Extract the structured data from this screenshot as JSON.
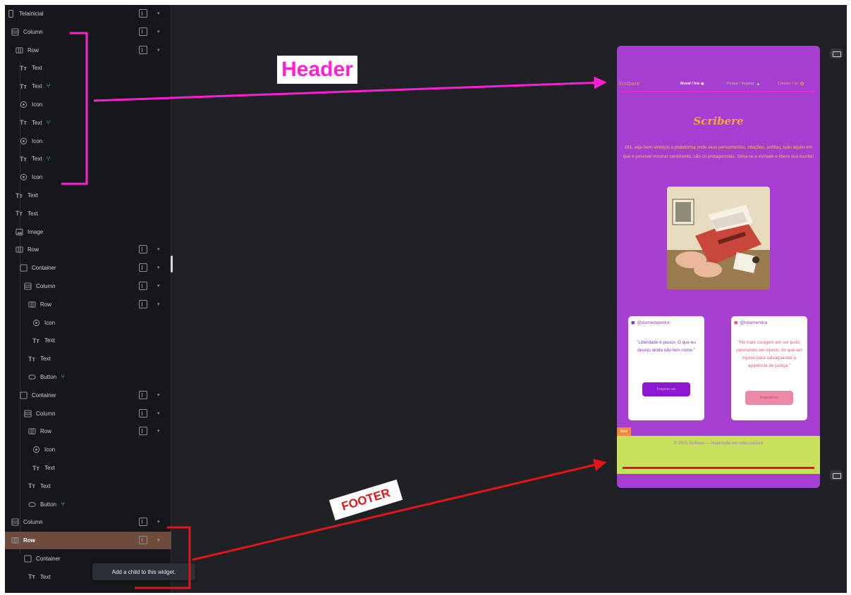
{
  "tree": {
    "items": [
      {
        "label": "Telainicial",
        "icon": "phone-icon",
        "wrap": true,
        "badge": false,
        "kind": "phone"
      },
      {
        "label": "Column",
        "icon": "column-icon",
        "wrap": true,
        "badge": false,
        "kind": "column"
      },
      {
        "label": "Row",
        "icon": "row-icon",
        "wrap": true,
        "badge": false,
        "kind": "row"
      },
      {
        "label": "Text",
        "icon": "text-icon",
        "wrap": false,
        "badge": false,
        "kind": "text"
      },
      {
        "label": "Text",
        "icon": "text-icon",
        "wrap": false,
        "badge": true,
        "kind": "text"
      },
      {
        "label": "Icon",
        "icon": "icon-widget-icon",
        "wrap": false,
        "badge": false,
        "kind": "icon"
      },
      {
        "label": "Text",
        "icon": "text-icon",
        "wrap": false,
        "badge": true,
        "kind": "text"
      },
      {
        "label": "Icon",
        "icon": "icon-widget-icon",
        "wrap": false,
        "badge": false,
        "kind": "icon"
      },
      {
        "label": "Text",
        "icon": "text-icon",
        "wrap": false,
        "badge": true,
        "kind": "text"
      },
      {
        "label": "Icon",
        "icon": "icon-widget-icon",
        "wrap": false,
        "badge": false,
        "kind": "icon"
      },
      {
        "label": "Text",
        "icon": "text-icon",
        "wrap": false,
        "badge": false,
        "kind": "text"
      },
      {
        "label": "Text",
        "icon": "text-icon",
        "wrap": false,
        "badge": false,
        "kind": "text"
      },
      {
        "label": "Image",
        "icon": "image-icon",
        "wrap": false,
        "badge": false,
        "kind": "image"
      },
      {
        "label": "Row",
        "icon": "row-icon",
        "wrap": true,
        "badge": false,
        "kind": "row"
      },
      {
        "label": "Container",
        "icon": "container-icon",
        "wrap": true,
        "badge": false,
        "kind": "container"
      },
      {
        "label": "Column",
        "icon": "column-icon",
        "wrap": true,
        "badge": false,
        "kind": "column"
      },
      {
        "label": "Row",
        "icon": "row-icon",
        "wrap": true,
        "badge": false,
        "kind": "row"
      },
      {
        "label": "Icon",
        "icon": "icon-widget-icon",
        "wrap": false,
        "badge": false,
        "kind": "icon"
      },
      {
        "label": "Text",
        "icon": "text-icon",
        "wrap": false,
        "badge": false,
        "kind": "text"
      },
      {
        "label": "Text",
        "icon": "text-icon",
        "wrap": false,
        "badge": false,
        "kind": "text"
      },
      {
        "label": "Button",
        "icon": "button-icon",
        "wrap": false,
        "badge": true,
        "kind": "button"
      },
      {
        "label": "Container",
        "icon": "container-icon",
        "wrap": true,
        "badge": false,
        "kind": "container"
      },
      {
        "label": "Column",
        "icon": "column-icon",
        "wrap": true,
        "badge": false,
        "kind": "column"
      },
      {
        "label": "Row",
        "icon": "row-icon",
        "wrap": true,
        "badge": false,
        "kind": "row"
      },
      {
        "label": "Icon",
        "icon": "icon-widget-icon",
        "wrap": false,
        "badge": false,
        "kind": "icon"
      },
      {
        "label": "Text",
        "icon": "text-icon",
        "wrap": false,
        "badge": false,
        "kind": "text"
      },
      {
        "label": "Text",
        "icon": "text-icon",
        "wrap": false,
        "badge": false,
        "kind": "text"
      },
      {
        "label": "Button",
        "icon": "button-icon",
        "wrap": false,
        "badge": true,
        "kind": "button"
      },
      {
        "label": "Column",
        "icon": "column-icon",
        "wrap": true,
        "badge": false,
        "kind": "column"
      },
      {
        "label": "Row",
        "icon": "row-icon",
        "wrap": true,
        "badge": false,
        "kind": "row",
        "selected": true
      },
      {
        "label": "Container",
        "icon": "container-icon",
        "wrap": false,
        "badge": false,
        "kind": "container"
      },
      {
        "label": "Text",
        "icon": "text-icon",
        "wrap": false,
        "badge": false,
        "kind": "text"
      }
    ],
    "tooltip": "Add a child to this widget."
  },
  "preview": {
    "brand": "Scribere",
    "nav": [
      {
        "label": "Mural / Ins",
        "icon": "person-icon"
      },
      {
        "label": "Postar / Inspirar",
        "icon": "leaf-icon"
      },
      {
        "label": "Contact / ler",
        "icon": "flower-icon"
      }
    ],
    "title": "Scribere",
    "intro": "Olá, seja bem-vindo(a) a plataforma onde seus pensamentos, citações, sortilas, tudo aquilo em que é possível mostrar sentimento, são os protagonistas. Sinta-se a vontade e libere sua escrita!",
    "cards": [
      {
        "handle": "@domedapedor",
        "quote": "\"Liberdade é pouco. O que eu desejo ainda não tem nome.\"",
        "button": "Inspirar-se"
      },
      {
        "handle": "@lolamendra",
        "quote": "\"Há mais coragem em ser justo, parecendo ser injusto, do que ser injusto para salvaguardar a aparência de justiça.\"",
        "button": "Inspirar-se"
      }
    ],
    "row_tag": "Row",
    "footer": "© 2023 Scribere — Inspiração em cada palavra"
  },
  "annotations": {
    "header": "Header",
    "footer": "FOOTER"
  },
  "colors": {
    "phone_bg": "#a63ed1",
    "footer_bg": "#c7e25a",
    "header_accent": "#ff1fd3",
    "footer_accent": "#e0151a",
    "selected_row": "#6d4c3d"
  }
}
